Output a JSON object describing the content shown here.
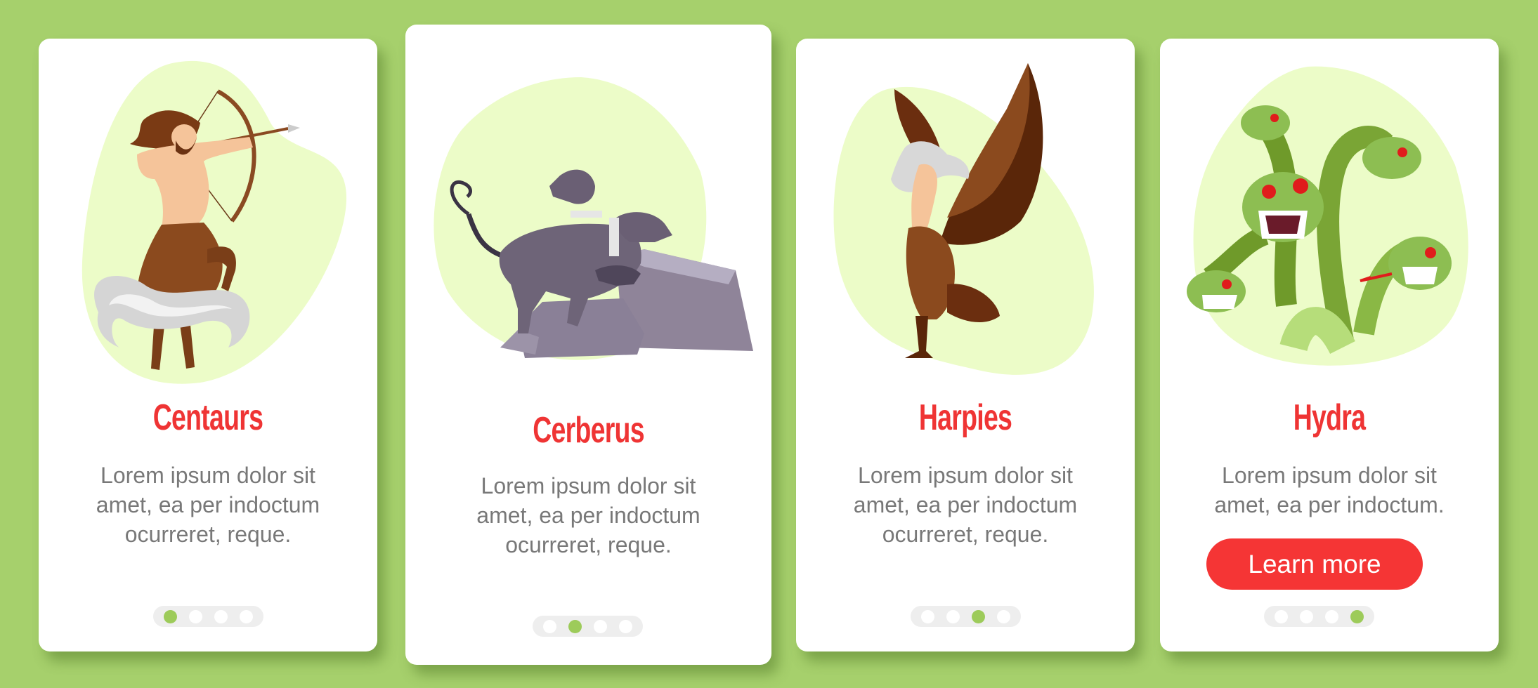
{
  "theme": {
    "background": "#a6d06c",
    "card": "#ffffff",
    "title_color": "#ef3434",
    "body_color": "#787878",
    "blob_color": "#ecfcc8",
    "pager_track": "#eeeeee",
    "pager_active": "#9dcb5a",
    "pager_inactive": "#ffffff",
    "button_color": "#f53535",
    "button_text_color": "#ffffff"
  },
  "cards": [
    {
      "title": "Centaurs",
      "illustration": "centaur-archer-illustration",
      "body_lines": [
        "Lorem ipsum dolor sit",
        "amet, ea per indoctum",
        "ocurreret, reque."
      ],
      "pager": {
        "total": 4,
        "active": 1
      }
    },
    {
      "title": "Cerberus",
      "illustration": "three-headed-dog-illustration",
      "body_lines": [
        "Lorem ipsum dolor sit",
        "amet, ea per indoctum",
        "ocurreret, reque."
      ],
      "pager": {
        "total": 4,
        "active": 2
      }
    },
    {
      "title": "Harpies",
      "illustration": "harpy-illustration",
      "body_lines": [
        "Lorem ipsum dolor sit",
        "amet, ea per indoctum",
        "ocurreret, reque."
      ],
      "pager": {
        "total": 4,
        "active": 3
      }
    },
    {
      "title": "Hydra",
      "illustration": "hydra-illustration",
      "body_lines": [
        "Lorem ipsum dolor sit",
        "amet, ea per indoctum."
      ],
      "button_label": "Learn more",
      "pager": {
        "total": 4,
        "active": 4
      }
    }
  ]
}
